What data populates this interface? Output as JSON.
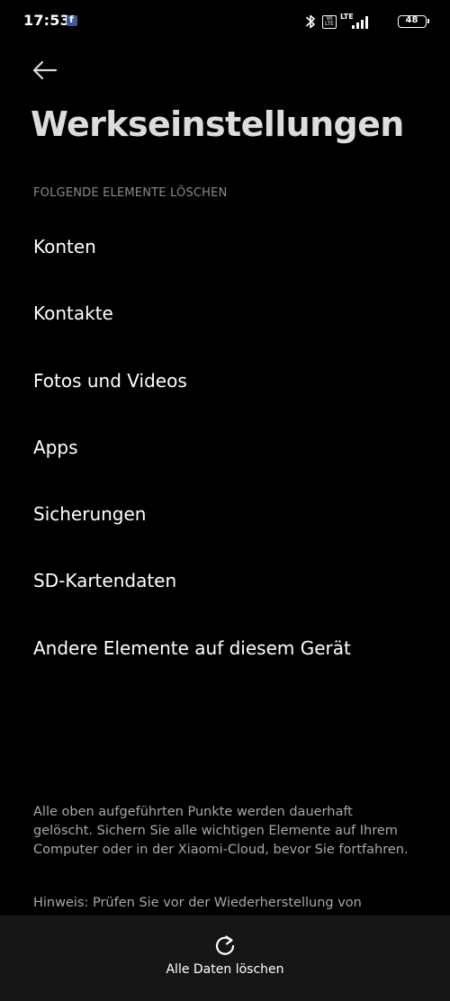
{
  "status_bar": {
    "time": "17:53",
    "network_label": "LTE",
    "volte_label": "Vo LTE",
    "battery_level": "48"
  },
  "header": {
    "title": "Werkseinstellungen"
  },
  "section": {
    "header": "FOLGENDE ELEMENTE LÖSCHEN",
    "items": [
      {
        "label": "Konten"
      },
      {
        "label": "Kontakte"
      },
      {
        "label": "Fotos und Videos"
      },
      {
        "label": "Apps"
      },
      {
        "label": "Sicherungen"
      },
      {
        "label": "SD-Kartendaten"
      },
      {
        "label": "Andere Elemente auf diesem Gerät"
      }
    ]
  },
  "footer": {
    "warning": "Alle oben aufgeführten Punkte werden dauerhaft gelöscht. Sichern Sie alle wichtigen Elemente auf Ihrem Computer oder in der Xiaomi-Cloud, bevor Sie fortfahren.",
    "hint": "Hinweis: Prüfen Sie vor der Wiederherstellung von"
  },
  "bottom_action": {
    "label": "Alle Daten löschen",
    "icon": "reset-icon"
  },
  "colors": {
    "background": "#000000",
    "title": "#dcdcdc",
    "section_header": "#8a8a8a",
    "body_text": "#a8a8a8",
    "bottom_bar": "#161616",
    "facebook_blue": "#3b5998"
  }
}
